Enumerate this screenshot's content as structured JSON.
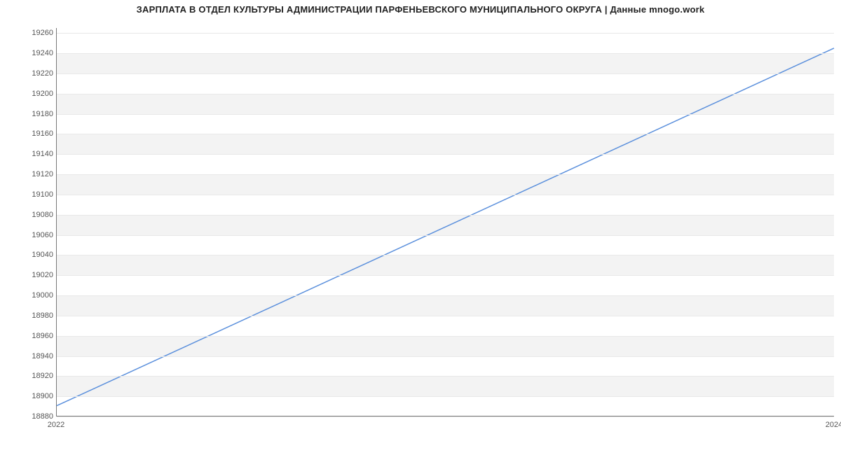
{
  "chart_data": {
    "type": "line",
    "title": "ЗАРПЛАТА В ОТДЕЛ КУЛЬТУРЫ АДМИНИСТРАЦИИ ПАРФЕНЬЕВСКОГО МУНИЦИПАЛЬНОГО ОКРУГА | Данные mnogo.work",
    "xlabel": "",
    "ylabel": "",
    "x": [
      2022,
      2024
    ],
    "values": [
      18890,
      19245
    ],
    "ylim": [
      18880,
      19265
    ],
    "xlim": [
      2022,
      2024
    ],
    "y_ticks": [
      18880,
      18900,
      18920,
      18940,
      18960,
      18980,
      19000,
      19020,
      19040,
      19060,
      19080,
      19100,
      19120,
      19140,
      19160,
      19180,
      19200,
      19220,
      19240,
      19260
    ],
    "x_ticks": [
      2022,
      2024
    ],
    "line_color": "#5a8fdc"
  }
}
